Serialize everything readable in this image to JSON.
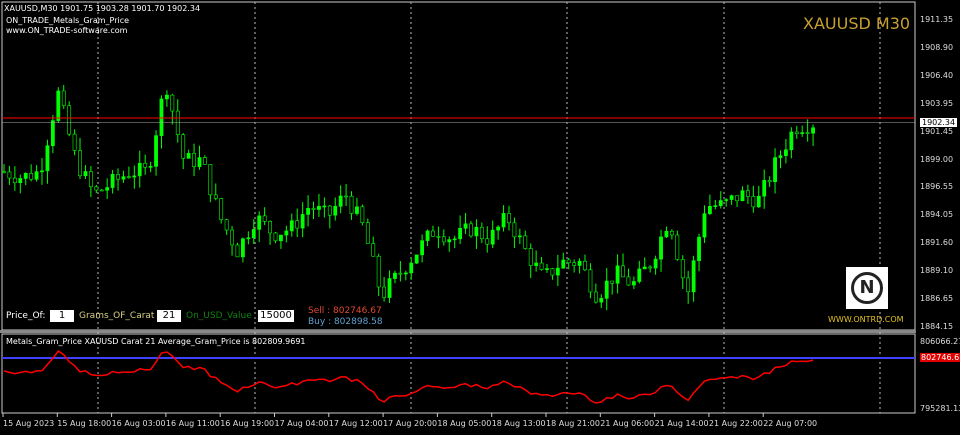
{
  "header": {
    "symbol_line": "XAUUSD,M30  1901.75 1903.28 1901.70 1902.34",
    "indicator_name": "ON_TRADE_Metals_Gram_Price",
    "website": "www.ON_TRADE-software.com"
  },
  "watermark": "XAUUSD M30",
  "inputs": {
    "price_of_label": "Price_Of:",
    "price_of_value": "1",
    "grams_label": "Grams_OF_Carat :",
    "grams_value": "21",
    "usd_label": "On_USD_Value",
    "usd_value": "15000"
  },
  "quotes": {
    "sell": "Sell : 802746.67",
    "buy": "Buy : 802898.58"
  },
  "logo": {
    "text": "WWW.ONTRD.COM",
    "glyph": "N"
  },
  "subwindow": {
    "label": "Metals_Gram_Price  XAUUSD   Carat  21   Average_Gram_Price is   802809.9691",
    "current_value": "802746.6",
    "axis": [
      "806066.27",
      "795281.13"
    ]
  },
  "colors": {
    "bull": "#00ff00",
    "bear": "#000000",
    "bid_line": "#ff0000",
    "indicator": "#ff0000",
    "level": "#4040ff",
    "watermark": "#c8a030"
  },
  "chart_data": {
    "type": "candlestick",
    "symbol": "XAUUSD",
    "timeframe": "M30",
    "ylim": [
      1884.15,
      1911.35
    ],
    "price_ticks": [
      "1911.35",
      "1908.90",
      "1906.40",
      "1903.95",
      "1901.45",
      "1899.00",
      "1896.55",
      "1894.05",
      "1891.60",
      "1889.10",
      "1886.65",
      "1884.15"
    ],
    "current_price": "1902.34",
    "bid_line": 1902.7,
    "time_labels": [
      "15 Aug 2023",
      "15 Aug 18:00",
      "16 Aug 03:00",
      "16 Aug 11:00",
      "16 Aug 19:00",
      "17 Aug 04:00",
      "17 Aug 12:00",
      "17 Aug 20:00",
      "18 Aug 05:00",
      "18 Aug 13:00",
      "18 Aug 21:00",
      "21 Aug 06:00",
      "21 Aug 14:00",
      "21 Aug 22:00",
      "22 Aug 07:00"
    ],
    "close_path": [
      1898,
      1897.5,
      1898,
      1905,
      1899,
      1896,
      1897,
      1898,
      1898,
      1906,
      1899,
      1899,
      1894,
      1891,
      1894,
      1892.5,
      1893,
      1895,
      1894,
      1896,
      1893,
      1887,
      1889,
      1891,
      1893,
      1892,
      1893,
      1892,
      1894,
      1891,
      1888.5,
      1890,
      1890,
      1887,
      1889,
      1888,
      1890,
      1894,
      1887,
      1895,
      1895,
      1896,
      1895.5,
      1899,
      1902,
      1902.3
    ]
  }
}
